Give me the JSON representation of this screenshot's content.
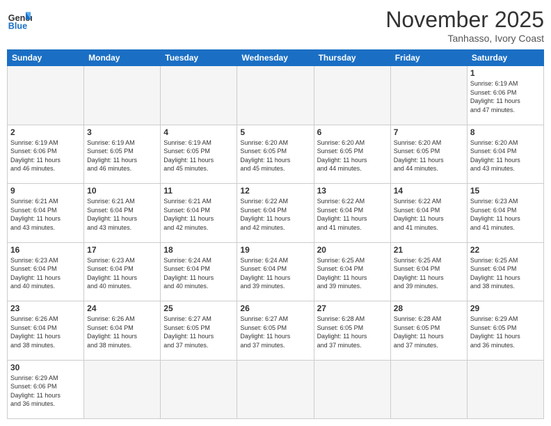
{
  "header": {
    "logo_general": "General",
    "logo_blue": "Blue",
    "month_title": "November 2025",
    "location": "Tanhasso, Ivory Coast"
  },
  "weekdays": [
    "Sunday",
    "Monday",
    "Tuesday",
    "Wednesday",
    "Thursday",
    "Friday",
    "Saturday"
  ],
  "days": [
    {
      "num": "",
      "empty": true,
      "text": ""
    },
    {
      "num": "",
      "empty": true,
      "text": ""
    },
    {
      "num": "",
      "empty": true,
      "text": ""
    },
    {
      "num": "",
      "empty": true,
      "text": ""
    },
    {
      "num": "",
      "empty": true,
      "text": ""
    },
    {
      "num": "",
      "empty": true,
      "text": ""
    },
    {
      "num": "1",
      "empty": false,
      "text": "Sunrise: 6:19 AM\nSunset: 6:06 PM\nDaylight: 11 hours\nand 47 minutes."
    },
    {
      "num": "2",
      "empty": false,
      "text": "Sunrise: 6:19 AM\nSunset: 6:06 PM\nDaylight: 11 hours\nand 46 minutes."
    },
    {
      "num": "3",
      "empty": false,
      "text": "Sunrise: 6:19 AM\nSunset: 6:05 PM\nDaylight: 11 hours\nand 46 minutes."
    },
    {
      "num": "4",
      "empty": false,
      "text": "Sunrise: 6:19 AM\nSunset: 6:05 PM\nDaylight: 11 hours\nand 45 minutes."
    },
    {
      "num": "5",
      "empty": false,
      "text": "Sunrise: 6:20 AM\nSunset: 6:05 PM\nDaylight: 11 hours\nand 45 minutes."
    },
    {
      "num": "6",
      "empty": false,
      "text": "Sunrise: 6:20 AM\nSunset: 6:05 PM\nDaylight: 11 hours\nand 44 minutes."
    },
    {
      "num": "7",
      "empty": false,
      "text": "Sunrise: 6:20 AM\nSunset: 6:05 PM\nDaylight: 11 hours\nand 44 minutes."
    },
    {
      "num": "8",
      "empty": false,
      "text": "Sunrise: 6:20 AM\nSunset: 6:04 PM\nDaylight: 11 hours\nand 43 minutes."
    },
    {
      "num": "9",
      "empty": false,
      "text": "Sunrise: 6:21 AM\nSunset: 6:04 PM\nDaylight: 11 hours\nand 43 minutes."
    },
    {
      "num": "10",
      "empty": false,
      "text": "Sunrise: 6:21 AM\nSunset: 6:04 PM\nDaylight: 11 hours\nand 43 minutes."
    },
    {
      "num": "11",
      "empty": false,
      "text": "Sunrise: 6:21 AM\nSunset: 6:04 PM\nDaylight: 11 hours\nand 42 minutes."
    },
    {
      "num": "12",
      "empty": false,
      "text": "Sunrise: 6:22 AM\nSunset: 6:04 PM\nDaylight: 11 hours\nand 42 minutes."
    },
    {
      "num": "13",
      "empty": false,
      "text": "Sunrise: 6:22 AM\nSunset: 6:04 PM\nDaylight: 11 hours\nand 41 minutes."
    },
    {
      "num": "14",
      "empty": false,
      "text": "Sunrise: 6:22 AM\nSunset: 6:04 PM\nDaylight: 11 hours\nand 41 minutes."
    },
    {
      "num": "15",
      "empty": false,
      "text": "Sunrise: 6:23 AM\nSunset: 6:04 PM\nDaylight: 11 hours\nand 41 minutes."
    },
    {
      "num": "16",
      "empty": false,
      "text": "Sunrise: 6:23 AM\nSunset: 6:04 PM\nDaylight: 11 hours\nand 40 minutes."
    },
    {
      "num": "17",
      "empty": false,
      "text": "Sunrise: 6:23 AM\nSunset: 6:04 PM\nDaylight: 11 hours\nand 40 minutes."
    },
    {
      "num": "18",
      "empty": false,
      "text": "Sunrise: 6:24 AM\nSunset: 6:04 PM\nDaylight: 11 hours\nand 40 minutes."
    },
    {
      "num": "19",
      "empty": false,
      "text": "Sunrise: 6:24 AM\nSunset: 6:04 PM\nDaylight: 11 hours\nand 39 minutes."
    },
    {
      "num": "20",
      "empty": false,
      "text": "Sunrise: 6:25 AM\nSunset: 6:04 PM\nDaylight: 11 hours\nand 39 minutes."
    },
    {
      "num": "21",
      "empty": false,
      "text": "Sunrise: 6:25 AM\nSunset: 6:04 PM\nDaylight: 11 hours\nand 39 minutes."
    },
    {
      "num": "22",
      "empty": false,
      "text": "Sunrise: 6:25 AM\nSunset: 6:04 PM\nDaylight: 11 hours\nand 38 minutes."
    },
    {
      "num": "23",
      "empty": false,
      "text": "Sunrise: 6:26 AM\nSunset: 6:04 PM\nDaylight: 11 hours\nand 38 minutes."
    },
    {
      "num": "24",
      "empty": false,
      "text": "Sunrise: 6:26 AM\nSunset: 6:04 PM\nDaylight: 11 hours\nand 38 minutes."
    },
    {
      "num": "25",
      "empty": false,
      "text": "Sunrise: 6:27 AM\nSunset: 6:05 PM\nDaylight: 11 hours\nand 37 minutes."
    },
    {
      "num": "26",
      "empty": false,
      "text": "Sunrise: 6:27 AM\nSunset: 6:05 PM\nDaylight: 11 hours\nand 37 minutes."
    },
    {
      "num": "27",
      "empty": false,
      "text": "Sunrise: 6:28 AM\nSunset: 6:05 PM\nDaylight: 11 hours\nand 37 minutes."
    },
    {
      "num": "28",
      "empty": false,
      "text": "Sunrise: 6:28 AM\nSunset: 6:05 PM\nDaylight: 11 hours\nand 37 minutes."
    },
    {
      "num": "29",
      "empty": false,
      "text": "Sunrise: 6:29 AM\nSunset: 6:05 PM\nDaylight: 11 hours\nand 36 minutes."
    },
    {
      "num": "30",
      "empty": false,
      "text": "Sunrise: 6:29 AM\nSunset: 6:06 PM\nDaylight: 11 hours\nand 36 minutes."
    },
    {
      "num": "",
      "empty": true,
      "text": ""
    },
    {
      "num": "",
      "empty": true,
      "text": ""
    },
    {
      "num": "",
      "empty": true,
      "text": ""
    },
    {
      "num": "",
      "empty": true,
      "text": ""
    },
    {
      "num": "",
      "empty": true,
      "text": ""
    },
    {
      "num": "",
      "empty": true,
      "text": ""
    }
  ]
}
